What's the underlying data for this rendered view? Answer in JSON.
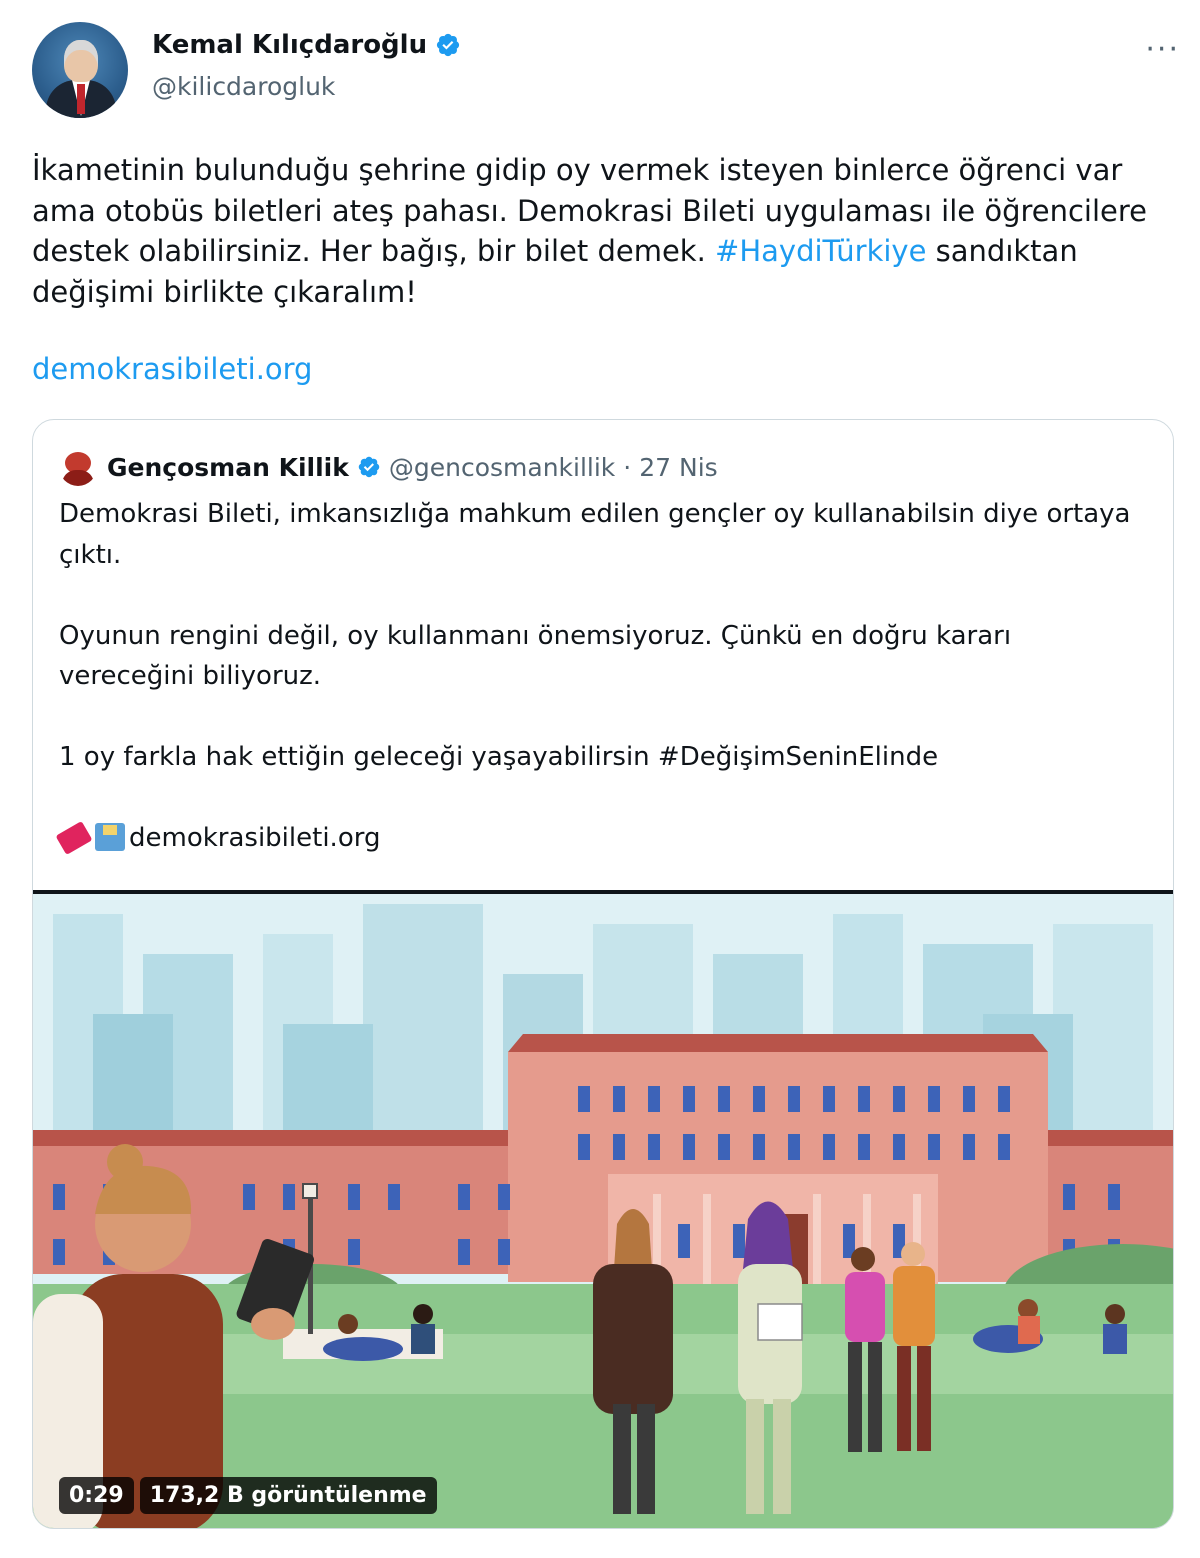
{
  "author": {
    "name": "Kemal Kılıçdaroğlu",
    "handle": "@kilicdarogluk"
  },
  "tweet": {
    "text_parts": [
      "İkametinin bulunduğu şehrine gidip oy vermek isteyen binlerce öğrenci var ama otobüs biletleri ateş pahası. Demokrasi Bileti uygulaması ile öğrencilere destek olabilirsiniz. Her bağış, bir bilet demek. ",
      "#HaydiTürkiye",
      " sandıktan değişimi birlikte çıkaralım!"
    ],
    "link": "demokrasibileti.org"
  },
  "quote": {
    "name": "Gençosman Killik",
    "handle": "@gencosmankillik",
    "separator": "·",
    "date": "27 Nis",
    "paragraphs": [
      "Demokrasi Bileti, imkansızlığa mahkum edilen gençler oy kullanabilsin diye ortaya çıktı.",
      "Oyunun rengini değil, oy kullanmanı önemsiyoruz. Çünkü en doğru kararı vereceğini biliyoruz.",
      "1 oy farkla hak ettiğin geleceği yaşayabilirsin #DeğişimSeninElinde"
    ],
    "link_line": "demokrasibileti.org",
    "video": {
      "duration": "0:29",
      "views": "173,2 B görüntülenme"
    }
  },
  "icons": [
    "verified-badge-icon",
    "more-icon",
    "ticket-emoji-icon",
    "ballot-box-emoji-icon"
  ],
  "colors": {
    "link": "#1d9bf0",
    "verified": "#1d9bf0",
    "secondary_text": "#536471"
  }
}
